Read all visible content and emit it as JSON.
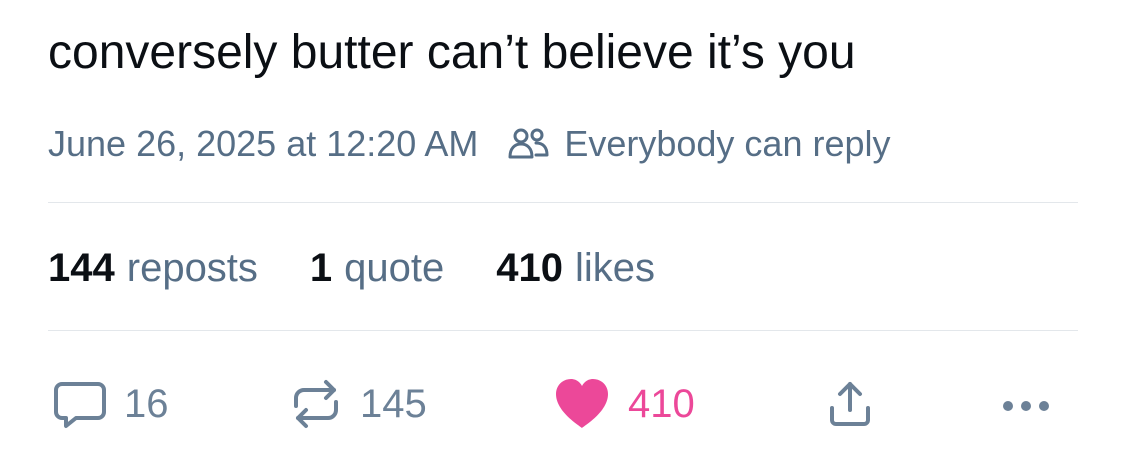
{
  "post": {
    "text": "conversely butter can’t believe it’s you"
  },
  "meta": {
    "timestamp": "June 26, 2025 at 12:20 AM",
    "reply_setting_icon": "people-icon",
    "reply_setting": "Everybody can reply"
  },
  "stats": {
    "reposts_count": "144",
    "reposts_label": "reposts",
    "quotes_count": "1",
    "quotes_label": "quote",
    "likes_count": "410",
    "likes_label": "likes"
  },
  "actions": {
    "reply": {
      "icon": "speech-bubble-icon",
      "count": "16"
    },
    "repost": {
      "icon": "repost-arrows-icon",
      "count": "145"
    },
    "like": {
      "icon": "heart-icon",
      "count": "410",
      "color": "#ec4899"
    },
    "share": {
      "icon": "share-icon"
    },
    "more": {
      "icon": "ellipsis-icon"
    }
  },
  "colors": {
    "text_primary": "#0b0f14",
    "text_secondary": "#566e86",
    "icon_gray": "#6c8197",
    "like_pink": "#ec4899",
    "divider": "#e3e7eb"
  }
}
